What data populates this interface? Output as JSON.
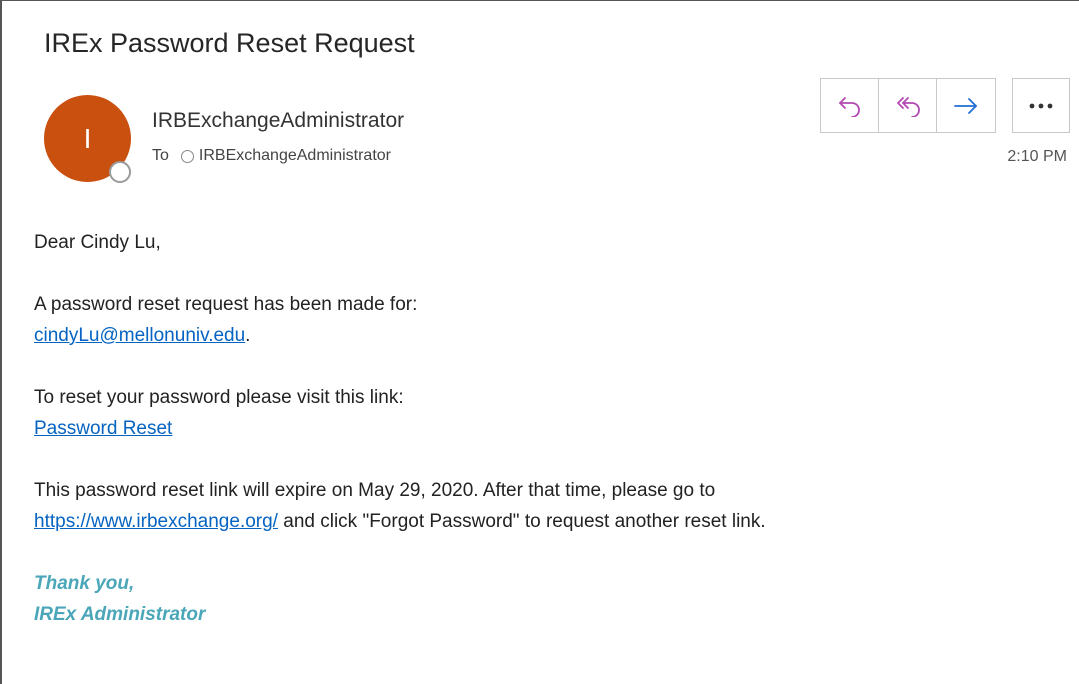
{
  "email": {
    "subject": "IREx Password Reset Request",
    "avatar_initial": "I",
    "sender": "IRBExchangeAdministrator",
    "to_label": "To",
    "recipient": "IRBExchangeAdministrator",
    "time": "2:10 PM",
    "actions": [
      {
        "label": "Reply",
        "icon": "reply-icon"
      },
      {
        "label": "Reply all",
        "icon": "reply-all-icon"
      },
      {
        "label": "Forward",
        "icon": "forward-icon"
      },
      {
        "label": "More actions",
        "icon": "more-icon"
      }
    ],
    "colors": {
      "avatar": "#ca5010",
      "action_icons": "#b347b3",
      "forward_icon": "#1f6fd6",
      "link": "#0563c1",
      "signature": "#4aa6b8"
    }
  },
  "body": {
    "greeting": "Dear Cindy Lu,",
    "reset_intro": "A password reset request has been made for:",
    "account_email": "cindyLu@mellonuniv.edu",
    "account_email_suffix": ".",
    "visit_text": "To reset your password please visit this link:",
    "reset_link": "Password Reset",
    "expire_text": "This password reset link will expire on May 29, 2020. After that time, please go to",
    "site_link": "https://www.irbexchange.org/",
    "site_suffix": " and click \"Forgot Password\" to request another reset link.",
    "signoff": "Thank you,",
    "signature": "IREx Administrator"
  }
}
